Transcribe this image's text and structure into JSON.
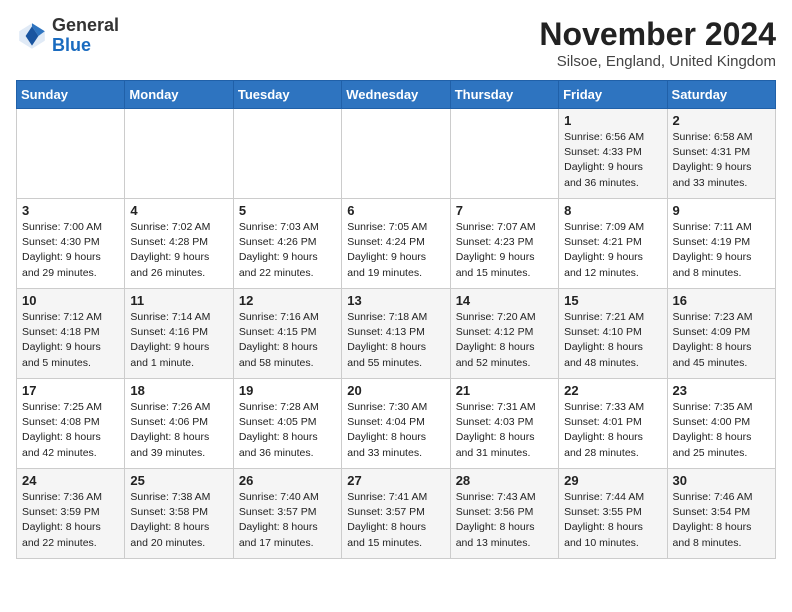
{
  "header": {
    "logo_general": "General",
    "logo_blue": "Blue",
    "month_title": "November 2024",
    "location": "Silsoe, England, United Kingdom"
  },
  "weekdays": [
    "Sunday",
    "Monday",
    "Tuesday",
    "Wednesday",
    "Thursday",
    "Friday",
    "Saturday"
  ],
  "weeks": [
    [
      {
        "day": "",
        "info": ""
      },
      {
        "day": "",
        "info": ""
      },
      {
        "day": "",
        "info": ""
      },
      {
        "day": "",
        "info": ""
      },
      {
        "day": "",
        "info": ""
      },
      {
        "day": "1",
        "info": "Sunrise: 6:56 AM\nSunset: 4:33 PM\nDaylight: 9 hours\nand 36 minutes."
      },
      {
        "day": "2",
        "info": "Sunrise: 6:58 AM\nSunset: 4:31 PM\nDaylight: 9 hours\nand 33 minutes."
      }
    ],
    [
      {
        "day": "3",
        "info": "Sunrise: 7:00 AM\nSunset: 4:30 PM\nDaylight: 9 hours\nand 29 minutes."
      },
      {
        "day": "4",
        "info": "Sunrise: 7:02 AM\nSunset: 4:28 PM\nDaylight: 9 hours\nand 26 minutes."
      },
      {
        "day": "5",
        "info": "Sunrise: 7:03 AM\nSunset: 4:26 PM\nDaylight: 9 hours\nand 22 minutes."
      },
      {
        "day": "6",
        "info": "Sunrise: 7:05 AM\nSunset: 4:24 PM\nDaylight: 9 hours\nand 19 minutes."
      },
      {
        "day": "7",
        "info": "Sunrise: 7:07 AM\nSunset: 4:23 PM\nDaylight: 9 hours\nand 15 minutes."
      },
      {
        "day": "8",
        "info": "Sunrise: 7:09 AM\nSunset: 4:21 PM\nDaylight: 9 hours\nand 12 minutes."
      },
      {
        "day": "9",
        "info": "Sunrise: 7:11 AM\nSunset: 4:19 PM\nDaylight: 9 hours\nand 8 minutes."
      }
    ],
    [
      {
        "day": "10",
        "info": "Sunrise: 7:12 AM\nSunset: 4:18 PM\nDaylight: 9 hours\nand 5 minutes."
      },
      {
        "day": "11",
        "info": "Sunrise: 7:14 AM\nSunset: 4:16 PM\nDaylight: 9 hours\nand 1 minute."
      },
      {
        "day": "12",
        "info": "Sunrise: 7:16 AM\nSunset: 4:15 PM\nDaylight: 8 hours\nand 58 minutes."
      },
      {
        "day": "13",
        "info": "Sunrise: 7:18 AM\nSunset: 4:13 PM\nDaylight: 8 hours\nand 55 minutes."
      },
      {
        "day": "14",
        "info": "Sunrise: 7:20 AM\nSunset: 4:12 PM\nDaylight: 8 hours\nand 52 minutes."
      },
      {
        "day": "15",
        "info": "Sunrise: 7:21 AM\nSunset: 4:10 PM\nDaylight: 8 hours\nand 48 minutes."
      },
      {
        "day": "16",
        "info": "Sunrise: 7:23 AM\nSunset: 4:09 PM\nDaylight: 8 hours\nand 45 minutes."
      }
    ],
    [
      {
        "day": "17",
        "info": "Sunrise: 7:25 AM\nSunset: 4:08 PM\nDaylight: 8 hours\nand 42 minutes."
      },
      {
        "day": "18",
        "info": "Sunrise: 7:26 AM\nSunset: 4:06 PM\nDaylight: 8 hours\nand 39 minutes."
      },
      {
        "day": "19",
        "info": "Sunrise: 7:28 AM\nSunset: 4:05 PM\nDaylight: 8 hours\nand 36 minutes."
      },
      {
        "day": "20",
        "info": "Sunrise: 7:30 AM\nSunset: 4:04 PM\nDaylight: 8 hours\nand 33 minutes."
      },
      {
        "day": "21",
        "info": "Sunrise: 7:31 AM\nSunset: 4:03 PM\nDaylight: 8 hours\nand 31 minutes."
      },
      {
        "day": "22",
        "info": "Sunrise: 7:33 AM\nSunset: 4:01 PM\nDaylight: 8 hours\nand 28 minutes."
      },
      {
        "day": "23",
        "info": "Sunrise: 7:35 AM\nSunset: 4:00 PM\nDaylight: 8 hours\nand 25 minutes."
      }
    ],
    [
      {
        "day": "24",
        "info": "Sunrise: 7:36 AM\nSunset: 3:59 PM\nDaylight: 8 hours\nand 22 minutes."
      },
      {
        "day": "25",
        "info": "Sunrise: 7:38 AM\nSunset: 3:58 PM\nDaylight: 8 hours\nand 20 minutes."
      },
      {
        "day": "26",
        "info": "Sunrise: 7:40 AM\nSunset: 3:57 PM\nDaylight: 8 hours\nand 17 minutes."
      },
      {
        "day": "27",
        "info": "Sunrise: 7:41 AM\nSunset: 3:57 PM\nDaylight: 8 hours\nand 15 minutes."
      },
      {
        "day": "28",
        "info": "Sunrise: 7:43 AM\nSunset: 3:56 PM\nDaylight: 8 hours\nand 13 minutes."
      },
      {
        "day": "29",
        "info": "Sunrise: 7:44 AM\nSunset: 3:55 PM\nDaylight: 8 hours\nand 10 minutes."
      },
      {
        "day": "30",
        "info": "Sunrise: 7:46 AM\nSunset: 3:54 PM\nDaylight: 8 hours\nand 8 minutes."
      }
    ]
  ]
}
